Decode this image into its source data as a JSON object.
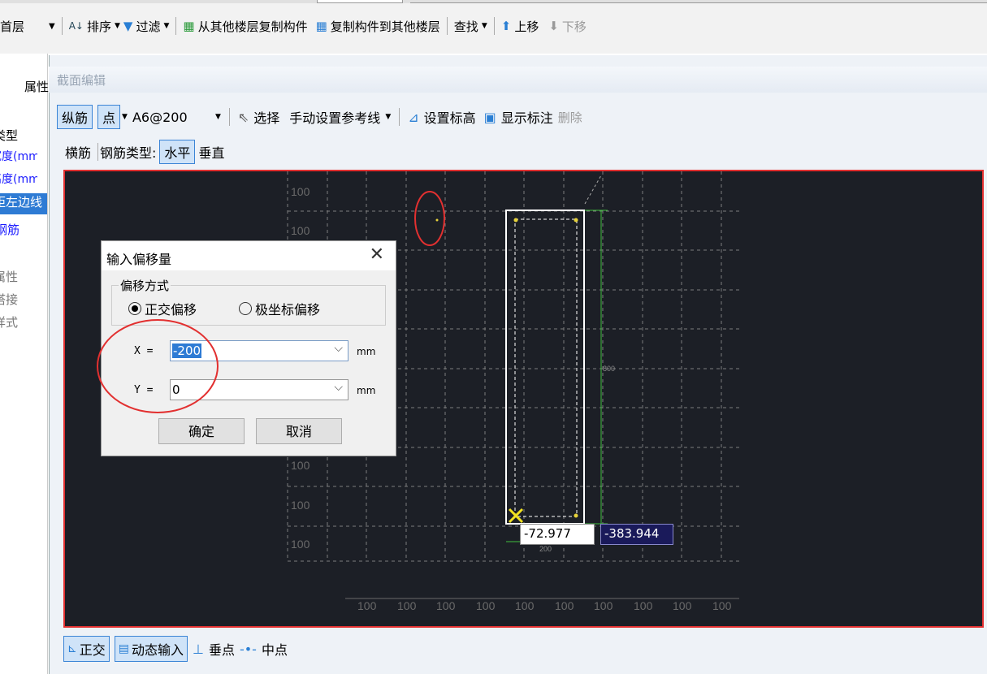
{
  "top_toolbar": {
    "floor_value": "首层",
    "sort_label": "排序",
    "filter_label": "过滤",
    "copy_from_floor_label": "从其他楼层复制构件",
    "copy_to_floor_label": "复制构件到其他楼层",
    "find_label": "查找",
    "move_up_label": "上移",
    "move_down_label": "下移"
  },
  "left_panel": {
    "header": "属性",
    "items": [
      {
        "label": "类型",
        "style": "normal"
      },
      {
        "label": "宽度(mm)",
        "style": "blue"
      },
      {
        "label": "高度(mm)",
        "style": "blue"
      },
      {
        "label": "距左边线",
        "style": "selected"
      },
      {
        "label": "钢筋",
        "style": "blue"
      },
      {
        "label": "属性",
        "style": "gray"
      },
      {
        "label": "搭接",
        "style": "gray"
      },
      {
        "label": "样式",
        "style": "gray"
      }
    ]
  },
  "window": {
    "title": "截面编辑"
  },
  "toolbar1": {
    "longitudinal": "纵筋",
    "point": "点",
    "rebar_spec": "A6@200",
    "select": "选择",
    "manual_ref_line": "手动设置参考线",
    "set_elevation": "设置标高",
    "show_annotation": "显示标注",
    "delete": "删除"
  },
  "toolbar2": {
    "transverse": "横筋",
    "rebar_type_label": "钢筋类型:",
    "horizontal": "水平",
    "vertical": "垂直"
  },
  "canvas": {
    "left_grid_labels": [
      "100",
      "100",
      "100",
      "100",
      "100",
      "100",
      "100",
      "100",
      "100",
      "100"
    ],
    "bottom_grid_labels": [
      "100",
      "100",
      "100",
      "100",
      "100",
      "100",
      "100",
      "100",
      "100",
      "100"
    ],
    "height_dim": "800",
    "width_dim": "200",
    "coord_x": "-72.977",
    "coord_y": "-383.944"
  },
  "dialog": {
    "title": "输入偏移量",
    "group_label": "偏移方式",
    "option_orthogonal": "正交偏移",
    "option_polar": "极坐标偏移",
    "x_label": "X =",
    "x_value": "-200",
    "y_label": "Y =",
    "y_value": "0",
    "unit_x": "mm",
    "unit_y": "mm",
    "ok": "确定",
    "cancel": "取消"
  },
  "bottom_bar": {
    "orthogonal": "正交",
    "dynamic_input": "动态输入",
    "perpendicular": "垂点",
    "midpoint": "中点"
  },
  "colors": {
    "canvas_bg": "#1c1f26",
    "highlight_red": "#e23030",
    "dim_green": "#3fbf3f",
    "selection_blue": "#cfe3f8",
    "accent_blue": "#3a84d6"
  }
}
